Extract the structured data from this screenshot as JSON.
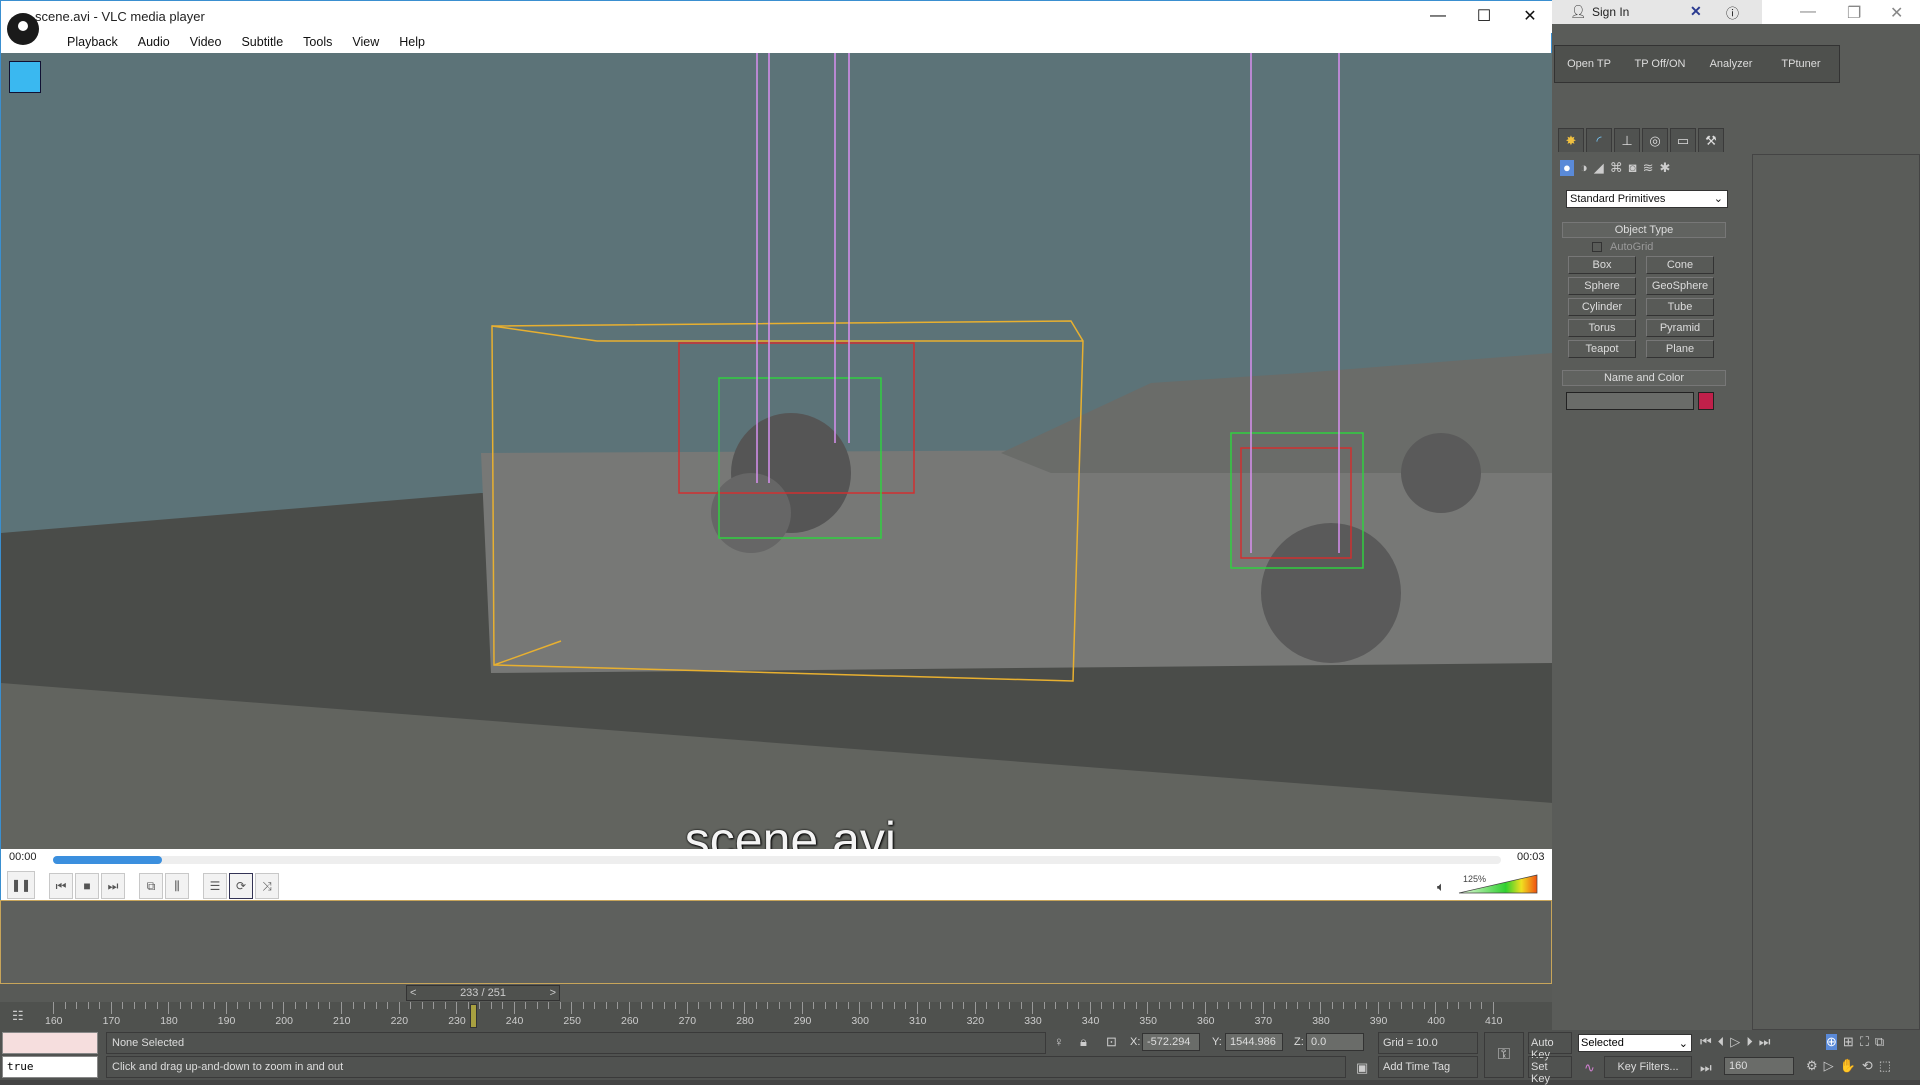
{
  "vlc": {
    "title": "scene.avi - VLC media player",
    "menu": [
      "Playback",
      "Audio",
      "Video",
      "Subtitle",
      "Tools",
      "View",
      "Help"
    ],
    "subtitle": "_scene.avi",
    "time_elapsed": "00:00",
    "time_total": "00:03",
    "progress_percent": 7.5,
    "volume_label": "125%",
    "volume_percent": 125,
    "accent": "#3b8fde"
  },
  "max": {
    "topbar": {
      "sign_in": "Sign In"
    },
    "tp_toolbar": [
      "Open TP",
      "TP Off/ON",
      "Analyzer",
      "TPtuner"
    ],
    "category_dropdown": "Standard Primitives",
    "object_type": {
      "header": "Object Type",
      "autogrid": "AutoGrid",
      "buttons": [
        "Box",
        "Cone",
        "Sphere",
        "GeoSphere",
        "Cylinder",
        "Tube",
        "Torus",
        "Pyramid",
        "Teapot",
        "Plane"
      ]
    },
    "name_and_color": {
      "header": "Name and Color",
      "name_value": "",
      "color": "#c0204a"
    },
    "time_slider": {
      "label": "233 / 251",
      "prev": "<",
      "next": ">"
    },
    "ruler": {
      "ticks": [
        "160",
        "170",
        "180",
        "190",
        "200",
        "210",
        "220",
        "230",
        "240",
        "250",
        "260",
        "270",
        "280",
        "290",
        "300",
        "310",
        "320",
        "330",
        "340",
        "350",
        "360",
        "370",
        "380",
        "390",
        "400",
        "410"
      ],
      "current_frame": 233
    },
    "status": {
      "script_value": "true",
      "selection": "None Selected",
      "prompt": "Click and drag up-and-down to zoom in and out",
      "x_label": "X:",
      "x": "-572.294",
      "y_label": "Y:",
      "y": "1544.986",
      "z_label": "Z:",
      "z": "0.0",
      "grid": "Grid = 10.0",
      "add_time_tag": "Add Time Tag",
      "auto_key": "Auto Key",
      "set_key": "Set Key",
      "key_mode": "Selected",
      "key_filters": "Key Filters...",
      "frame": "160"
    }
  }
}
